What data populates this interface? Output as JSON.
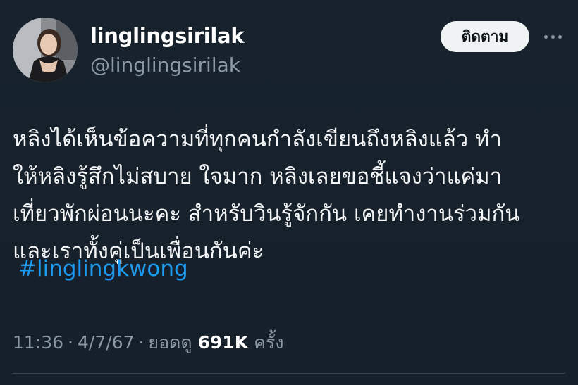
{
  "tweet": {
    "author": {
      "display_name": "linglingsirilak",
      "handle": "@linglingsirilak"
    },
    "follow_label": "ติดตาม",
    "more_icon": "more-horizontal-icon",
    "text_lines": [
      "หลิงได้เห็นข้อความที่ทุกคนกำลังเขียนถึงหลิงแล้ว ทำ",
      "ให้หลิงรู้สึกไม่สบาย ใจมาก หลิงเลยขอชี้แจงว่าแค่มา",
      "เที่ยวพักผ่อนนะคะ สำหรับวินรู้จักกัน เคยทำงานร่วมกัน",
      "และเราทั้งคู่เป็นเพื่อนกันค่ะ"
    ],
    "hashtag": "#linglingkwong",
    "time": "11:36",
    "date": "4/7/67",
    "views_label": "ยอดดู",
    "views_count": "691K",
    "views_unit": "ครั้ง",
    "separator": "·"
  },
  "colors": {
    "background": "#15202b",
    "link": "#1d9bf0",
    "muted": "#8b98a5",
    "button_bg": "#eff3f4"
  }
}
